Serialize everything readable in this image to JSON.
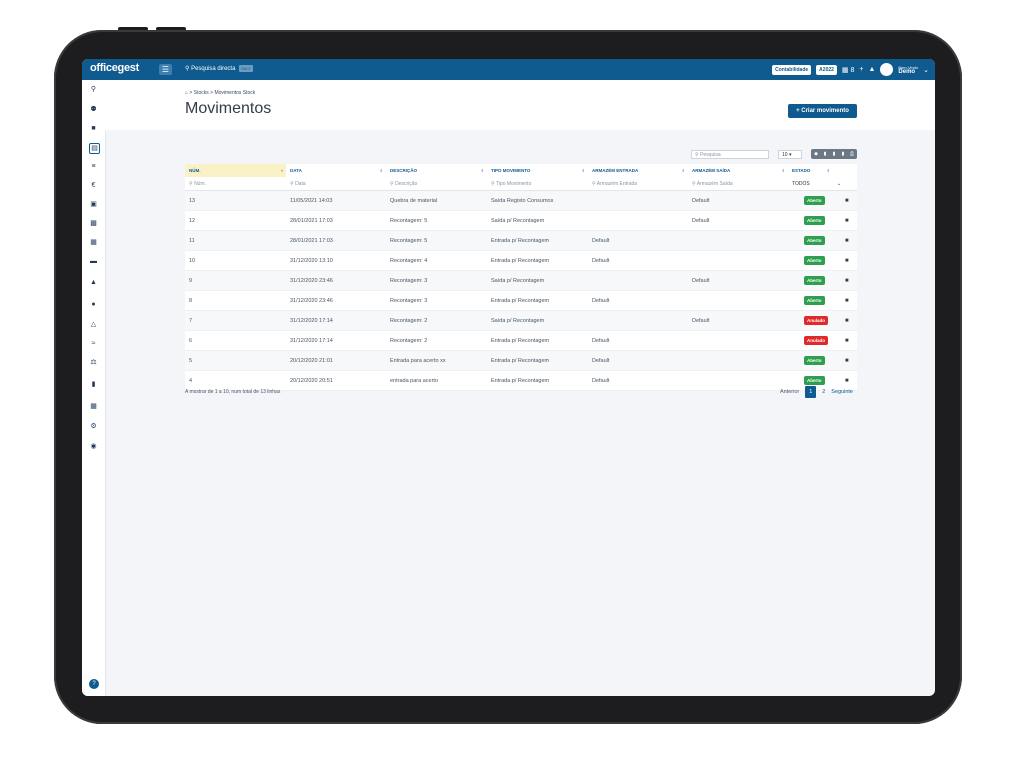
{
  "topbar": {
    "logo": "officegest",
    "quick_search": "Pesquisa directa",
    "shortcut": "Ctrl F",
    "accounting": "Contabilidade",
    "year": "A2022",
    "grid_count": "8",
    "welcome": "Bem-Vindo",
    "user": "Demo"
  },
  "breadcrumb": {
    "level1": "Stocks",
    "level2": "Movimentos Stock"
  },
  "page_title": "Movimentos",
  "create_button": "+ Criar movimento",
  "table_tools": {
    "search_placeholder": "Pesquisa",
    "page_length": "10"
  },
  "columns": [
    "NÚM.",
    "DATA",
    "DESCRIÇÃO",
    "TIPO MOVIMENTO",
    "ARMAZÉM ENTRADA",
    "ARMAZÉM SAÍDA",
    "ESTADO"
  ],
  "filters": [
    "Núm.",
    "Data",
    "Descrição",
    "Tipo Movimento",
    "Armazém Entrada",
    "Armazém Saída",
    "TODOS"
  ],
  "rows": [
    {
      "num": "13",
      "date": "11/05/2021 14:03",
      "desc": "Quebra de material",
      "type": "Saída Registo Consumos",
      "in": "",
      "out": "Default",
      "status": "Aberto"
    },
    {
      "num": "12",
      "date": "28/01/2021 17:03",
      "desc": "Recontagem: 5",
      "type": "Saída p/ Recontagem",
      "in": "",
      "out": "Default",
      "status": "Aberto"
    },
    {
      "num": "11",
      "date": "28/01/2021 17:03",
      "desc": "Recontagem: 5",
      "type": "Entrada p/ Recontagem",
      "in": "Default",
      "out": "",
      "status": "Aberto"
    },
    {
      "num": "10",
      "date": "31/12/2020 13:10",
      "desc": "Recontagem: 4",
      "type": "Entrada p/ Recontagem",
      "in": "Default",
      "out": "",
      "status": "Aberto"
    },
    {
      "num": "9",
      "date": "31/12/2020 23:46",
      "desc": "Recontagem: 3",
      "type": "Saída p/ Recontagem",
      "in": "",
      "out": "Default",
      "status": "Aberto"
    },
    {
      "num": "8",
      "date": "31/12/2020 23:46",
      "desc": "Recontagem: 3",
      "type": "Entrada p/ Recontagem",
      "in": "Default",
      "out": "",
      "status": "Aberto"
    },
    {
      "num": "7",
      "date": "31/12/2020 17:14",
      "desc": "Recontagem: 2",
      "type": "Saída p/ Recontagem",
      "in": "",
      "out": "Default",
      "status": "Anulado"
    },
    {
      "num": "6",
      "date": "31/12/2020 17:14",
      "desc": "Recontagem: 2",
      "type": "Entrada p/ Recontagem",
      "in": "Default",
      "out": "",
      "status": "Anulado"
    },
    {
      "num": "5",
      "date": "20/12/2020 21:01",
      "desc": "Entrada para acerto xx",
      "type": "Entrada p/ Recontagem",
      "in": "Default",
      "out": "",
      "status": "Aberto"
    },
    {
      "num": "4",
      "date": "20/12/2020 20:51",
      "desc": "entrada para acerto",
      "type": "Entrada p/ Recontagem",
      "in": "Default",
      "out": "",
      "status": "Aberto"
    }
  ],
  "status_colors": {
    "Aberto": "#2e9e4f",
    "Anulado": "#e02a2a"
  },
  "footer_info": "A mostrar de 1 a 10, num total de 13 linhas",
  "pager": {
    "prev": "Anterior",
    "page1": "1",
    "page2": "2",
    "next": "Seguinte"
  }
}
